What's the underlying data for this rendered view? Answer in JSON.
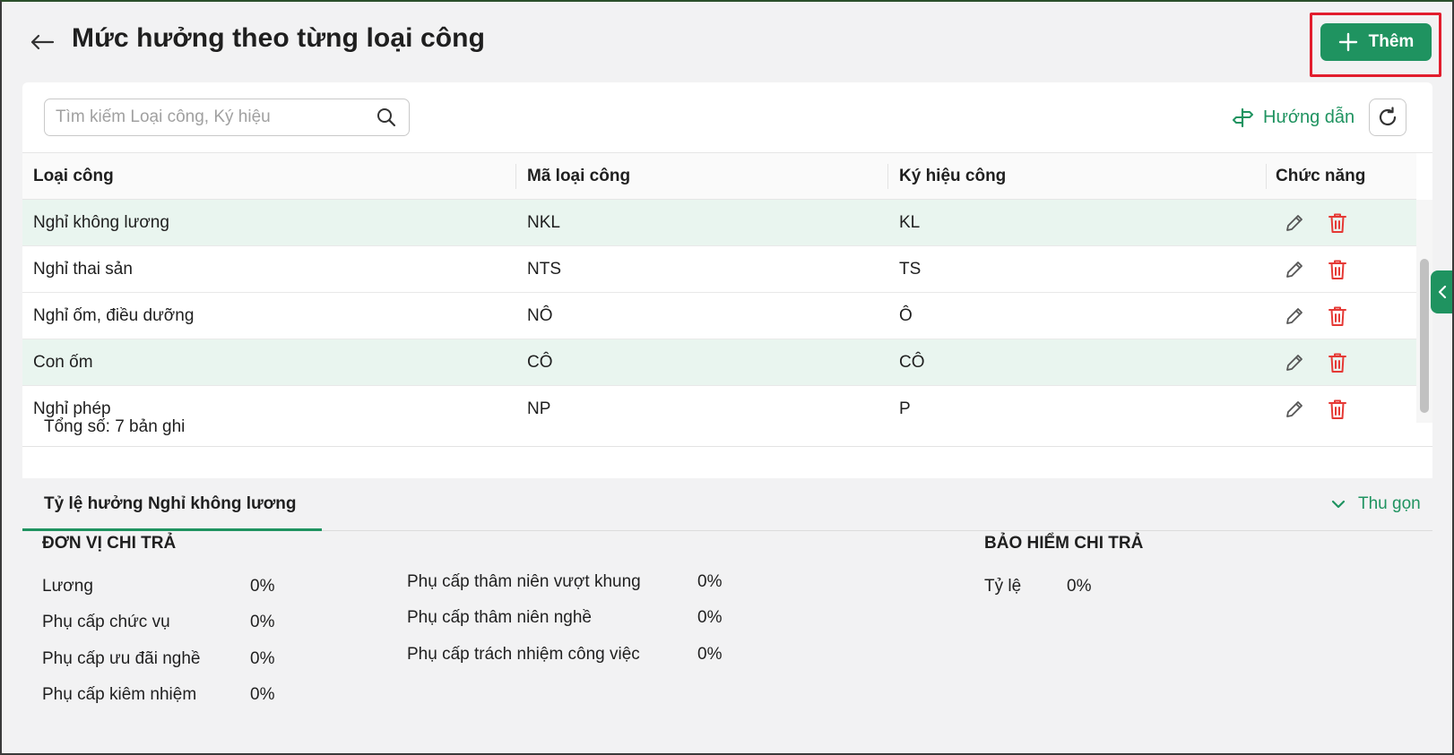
{
  "header": {
    "title": "Mức hưởng theo từng loại công",
    "add_label": "Thêm"
  },
  "toolbar": {
    "search_placeholder": "Tìm kiếm Loại công, Ký hiệu",
    "guide_label": "Hướng dẫn"
  },
  "table": {
    "columns": [
      "Loại công",
      "Mã loại công",
      "Ký hiệu công",
      "Chức năng"
    ],
    "rows": [
      {
        "name": "Nghỉ không lương",
        "code": "NKL",
        "symbol": "KL"
      },
      {
        "name": "Nghỉ thai sản",
        "code": "NTS",
        "symbol": "TS"
      },
      {
        "name": "Nghỉ ốm, điều dưỡng",
        "code": "NÔ",
        "symbol": "Ô"
      },
      {
        "name": "Con ốm",
        "code": "CÔ",
        "symbol": "CÔ"
      },
      {
        "name": "Nghỉ phép",
        "code": "NP",
        "symbol": "P"
      }
    ],
    "total_label": "Tổng số: 7 bản ghi"
  },
  "detail": {
    "tab_label": "Tỷ lệ hưởng Nghỉ không lương",
    "collapse_label": "Thu gọn",
    "employer_title": "ĐƠN VỊ CHI TRẢ",
    "employer_col1": [
      {
        "label": "Lương",
        "value": "0%"
      },
      {
        "label": "Phụ cấp chức vụ",
        "value": "0%"
      },
      {
        "label": "Phụ cấp ưu đãi nghề",
        "value": "0%"
      },
      {
        "label": "Phụ cấp kiêm nhiệm",
        "value": "0%"
      }
    ],
    "employer_col2": [
      {
        "label": "Phụ cấp thâm niên vượt khung",
        "value": "0%"
      },
      {
        "label": "Phụ cấp thâm niên nghề",
        "value": "0%"
      },
      {
        "label": "Phụ cấp trách nhiệm công việc",
        "value": "0%"
      }
    ],
    "insurance_title": "BẢO HIỂM CHI TRẢ",
    "insurance": [
      {
        "label": "Tỷ lệ",
        "value": "0%"
      }
    ]
  },
  "colors": {
    "accent": "#1f9360",
    "highlight": "#e21d2d",
    "delete": "#e53935",
    "row_stripe": "#e9f5ef"
  }
}
